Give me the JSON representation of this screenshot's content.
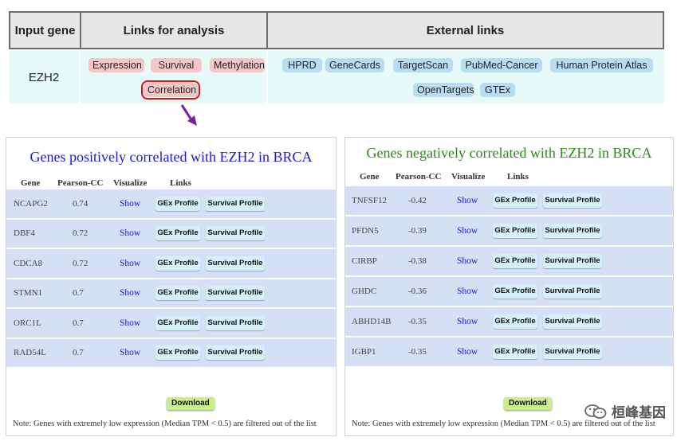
{
  "top": {
    "header_input_gene": "Input gene",
    "header_links_analysis": "Links for analysis",
    "header_external_links": "External links",
    "gene": "EZH2",
    "analysis_links": [
      "Expression",
      "Survival",
      "Methylation",
      "Correlation"
    ],
    "selected_analysis": "Correlation",
    "external_links": [
      "HPRD",
      "GeneCards",
      "TargetScan",
      "PubMed-Cancer",
      "Human Protein Atlas",
      "OpenTargets",
      "GTEx"
    ]
  },
  "positive": {
    "title": "Genes positively correlated with EZH2 in BRCA",
    "title_color": "#1a1ad6",
    "columns": [
      "Gene",
      "Pearson-CC",
      "Visualize",
      "Links"
    ],
    "rows": [
      {
        "gene": "NCAPG2",
        "pcc": "0.74",
        "viz": "Show",
        "b1": "GEx Profile",
        "b2": "Survival Profile"
      },
      {
        "gene": "DBF4",
        "pcc": "0.72",
        "viz": "Show",
        "b1": "GEx Profile",
        "b2": "Survival Profile"
      },
      {
        "gene": "CDCA8",
        "pcc": "0.72",
        "viz": "Show",
        "b1": "GEx Profile",
        "b2": "Survival Profile"
      },
      {
        "gene": "STMN1",
        "pcc": "0.7",
        "viz": "Show",
        "b1": "GEx Profile",
        "b2": "Survival Profile"
      },
      {
        "gene": "ORC1L",
        "pcc": "0.7",
        "viz": "Show",
        "b1": "GEx Profile",
        "b2": "Survival Profile"
      },
      {
        "gene": "RAD54L",
        "pcc": "0.7",
        "viz": "Show",
        "b1": "GEx Profile",
        "b2": "Survival Profile"
      }
    ],
    "download": "Download",
    "note": "Note: Genes with extremely low expression (Median TPM < 0.5) are filtered out of the list"
  },
  "negative": {
    "title": "Genes negatively correlated with EZH2 in BRCA",
    "title_color": "#2d8a1a",
    "columns": [
      "Gene",
      "Pearson-CC",
      "Visualize",
      "Links"
    ],
    "rows": [
      {
        "gene": "TNFSF12",
        "pcc": "-0.42",
        "viz": "Show",
        "b1": "GEx Profile",
        "b2": "Survival Profile"
      },
      {
        "gene": "PFDN5",
        "pcc": "-0.39",
        "viz": "Show",
        "b1": "GEx Profile",
        "b2": "Survival Profile"
      },
      {
        "gene": "CIRBP",
        "pcc": "-0.38",
        "viz": "Show",
        "b1": "GEx Profile",
        "b2": "Survival Profile"
      },
      {
        "gene": "GHDC",
        "pcc": "-0.36",
        "viz": "Show",
        "b1": "GEx Profile",
        "b2": "Survival Profile"
      },
      {
        "gene": "ABHD14B",
        "pcc": "-0.35",
        "viz": "Show",
        "b1": "GEx Profile",
        "b2": "Survival Profile"
      },
      {
        "gene": "IGBP1",
        "pcc": "-0.35",
        "viz": "Show",
        "b1": "GEx Profile",
        "b2": "Survival Profile"
      }
    ],
    "download": "Download",
    "note": "Note: Genes with extremely low expression (Median TPM < 0.5) are filtered out of the list"
  },
  "watermark": "桓峰基因"
}
